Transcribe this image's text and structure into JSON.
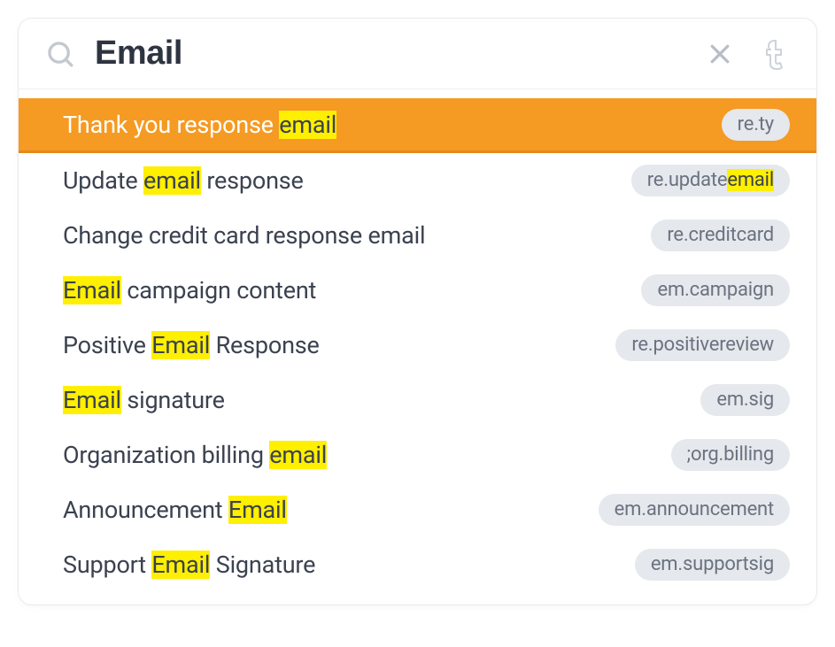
{
  "search": {
    "value": "Email",
    "placeholder": "Search"
  },
  "colors": {
    "highlight": "#ffef00",
    "selected_bg": "#f59a22",
    "selected_border": "#e4891b"
  },
  "results": [
    {
      "selected": true,
      "label_parts": [
        {
          "text": "Thank you response ",
          "hl": false
        },
        {
          "text": "email",
          "hl": true
        }
      ],
      "key_parts": [
        {
          "text": "re.ty",
          "hl": false
        }
      ]
    },
    {
      "selected": false,
      "label_parts": [
        {
          "text": "Update ",
          "hl": false
        },
        {
          "text": "email",
          "hl": true
        },
        {
          "text": " response",
          "hl": false
        }
      ],
      "key_parts": [
        {
          "text": "re.update",
          "hl": false
        },
        {
          "text": "email",
          "hl": true
        }
      ]
    },
    {
      "selected": false,
      "label_parts": [
        {
          "text": "Change credit card response email",
          "hl": false
        }
      ],
      "key_parts": [
        {
          "text": "re.creditcard",
          "hl": false
        }
      ]
    },
    {
      "selected": false,
      "label_parts": [
        {
          "text": "Email",
          "hl": true
        },
        {
          "text": " campaign content",
          "hl": false
        }
      ],
      "key_parts": [
        {
          "text": "em.campaign",
          "hl": false
        }
      ]
    },
    {
      "selected": false,
      "label_parts": [
        {
          "text": "Positive ",
          "hl": false
        },
        {
          "text": "Email",
          "hl": true
        },
        {
          "text": " Response",
          "hl": false
        }
      ],
      "key_parts": [
        {
          "text": "re.positivereview",
          "hl": false
        }
      ]
    },
    {
      "selected": false,
      "label_parts": [
        {
          "text": "Email",
          "hl": true
        },
        {
          "text": " signature",
          "hl": false
        }
      ],
      "key_parts": [
        {
          "text": "em.sig",
          "hl": false
        }
      ]
    },
    {
      "selected": false,
      "label_parts": [
        {
          "text": "Organization billing ",
          "hl": false
        },
        {
          "text": "email",
          "hl": true
        }
      ],
      "key_parts": [
        {
          "text": ";org.billing",
          "hl": false
        }
      ]
    },
    {
      "selected": false,
      "label_parts": [
        {
          "text": "Announcement ",
          "hl": false
        },
        {
          "text": "Email",
          "hl": true
        }
      ],
      "key_parts": [
        {
          "text": "em.announcement",
          "hl": false
        }
      ]
    },
    {
      "selected": false,
      "label_parts": [
        {
          "text": "Support ",
          "hl": false
        },
        {
          "text": "Email",
          "hl": true
        },
        {
          "text": " Signature",
          "hl": false
        }
      ],
      "key_parts": [
        {
          "text": "em.supportsig",
          "hl": false
        }
      ]
    }
  ]
}
